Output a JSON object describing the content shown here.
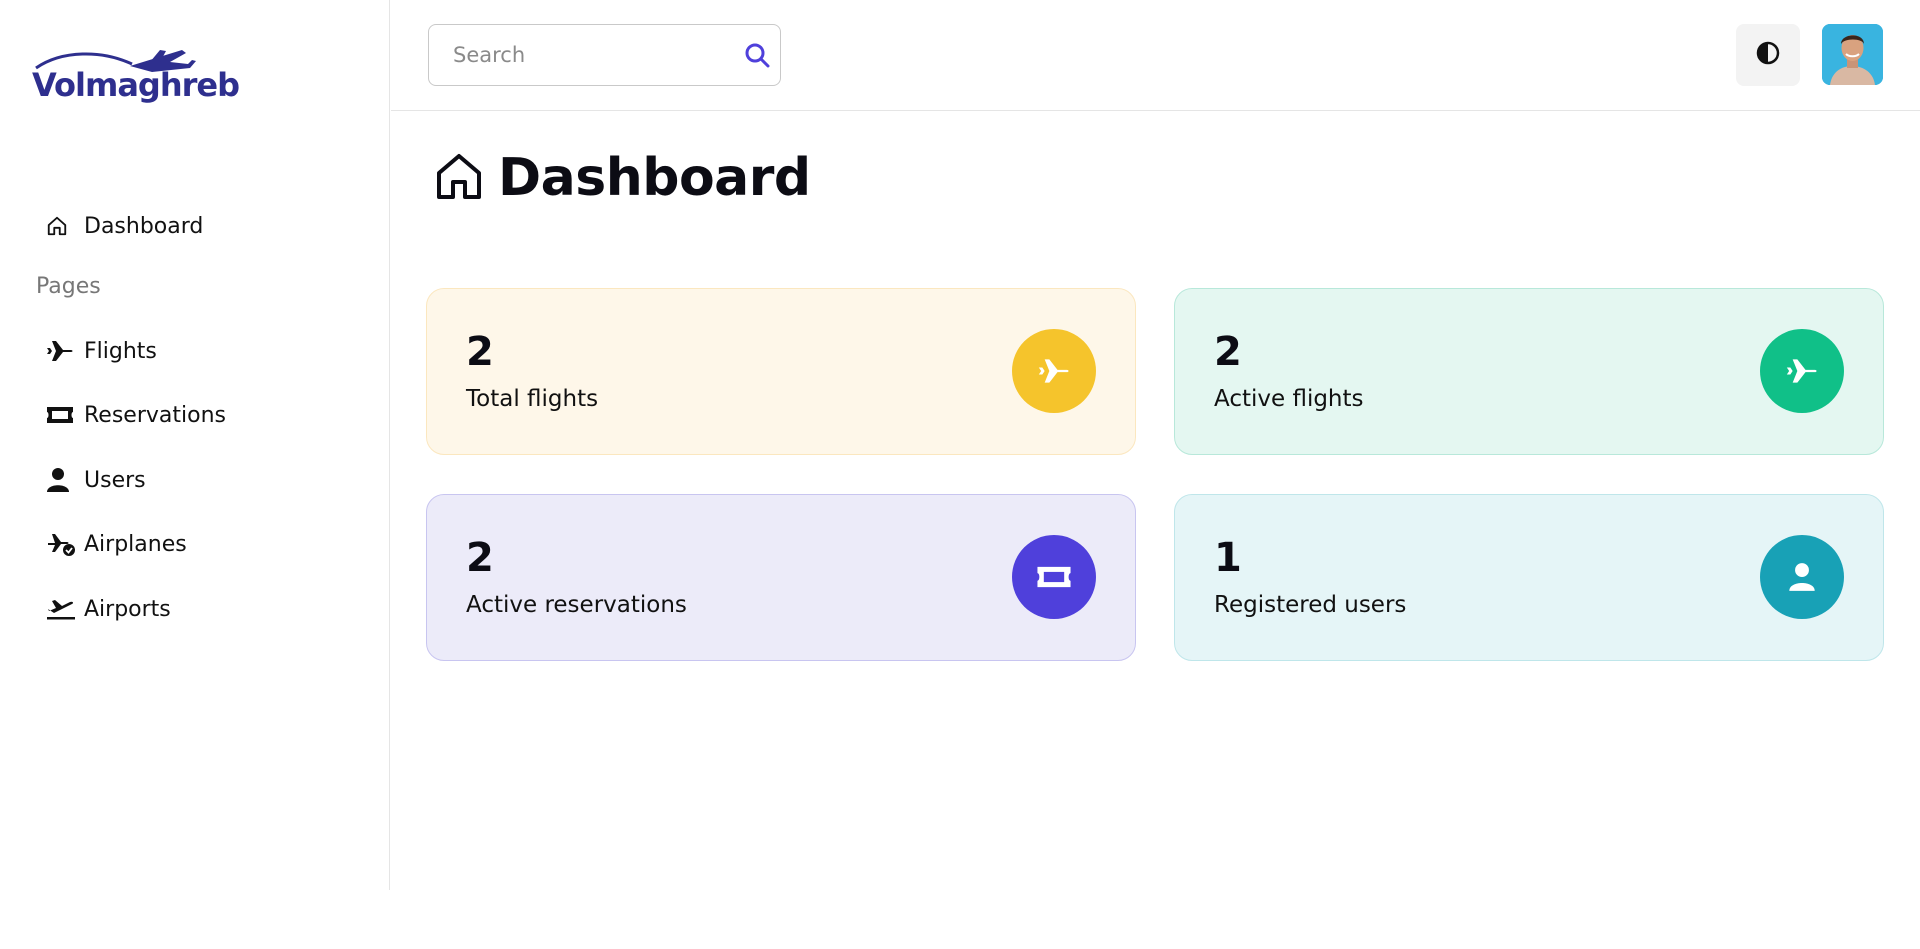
{
  "brand": {
    "name": "Volmaghreb",
    "color": "#2e2f8e"
  },
  "sidebar": {
    "dashboard_label": "Dashboard",
    "section_label": "Pages",
    "items": [
      {
        "label": "Flights",
        "icon": "plane-icon"
      },
      {
        "label": "Reservations",
        "icon": "ticket-icon"
      },
      {
        "label": "Users",
        "icon": "user-icon"
      },
      {
        "label": "Airplanes",
        "icon": "airplane-check-icon"
      },
      {
        "label": "Airports",
        "icon": "plane-departure-icon"
      }
    ]
  },
  "header": {
    "search_placeholder": "Search",
    "search_value": "",
    "theme_toggle_icon": "contrast-icon",
    "avatar_icon": "user-avatar"
  },
  "page": {
    "title": "Dashboard",
    "title_icon": "home-icon"
  },
  "stats": [
    {
      "value": "2",
      "label": "Total flights",
      "icon": "plane-icon",
      "bg": "#fef7e9",
      "border": "#fbe7bf",
      "accent": "#f5c42c"
    },
    {
      "value": "2",
      "label": "Active flights",
      "icon": "plane-icon",
      "bg": "#e4f7f1",
      "border": "#b8e8da",
      "accent": "#10c088"
    },
    {
      "value": "2",
      "label": "Active reservations",
      "icon": "ticket-icon",
      "bg": "#ecebf9",
      "border": "#c8c5f0",
      "accent": "#4f40db"
    },
    {
      "value": "1",
      "label": "Registered users",
      "icon": "user-icon",
      "bg": "#e5f5f7",
      "border": "#bfe6ea",
      "accent": "#18a1b6"
    }
  ]
}
